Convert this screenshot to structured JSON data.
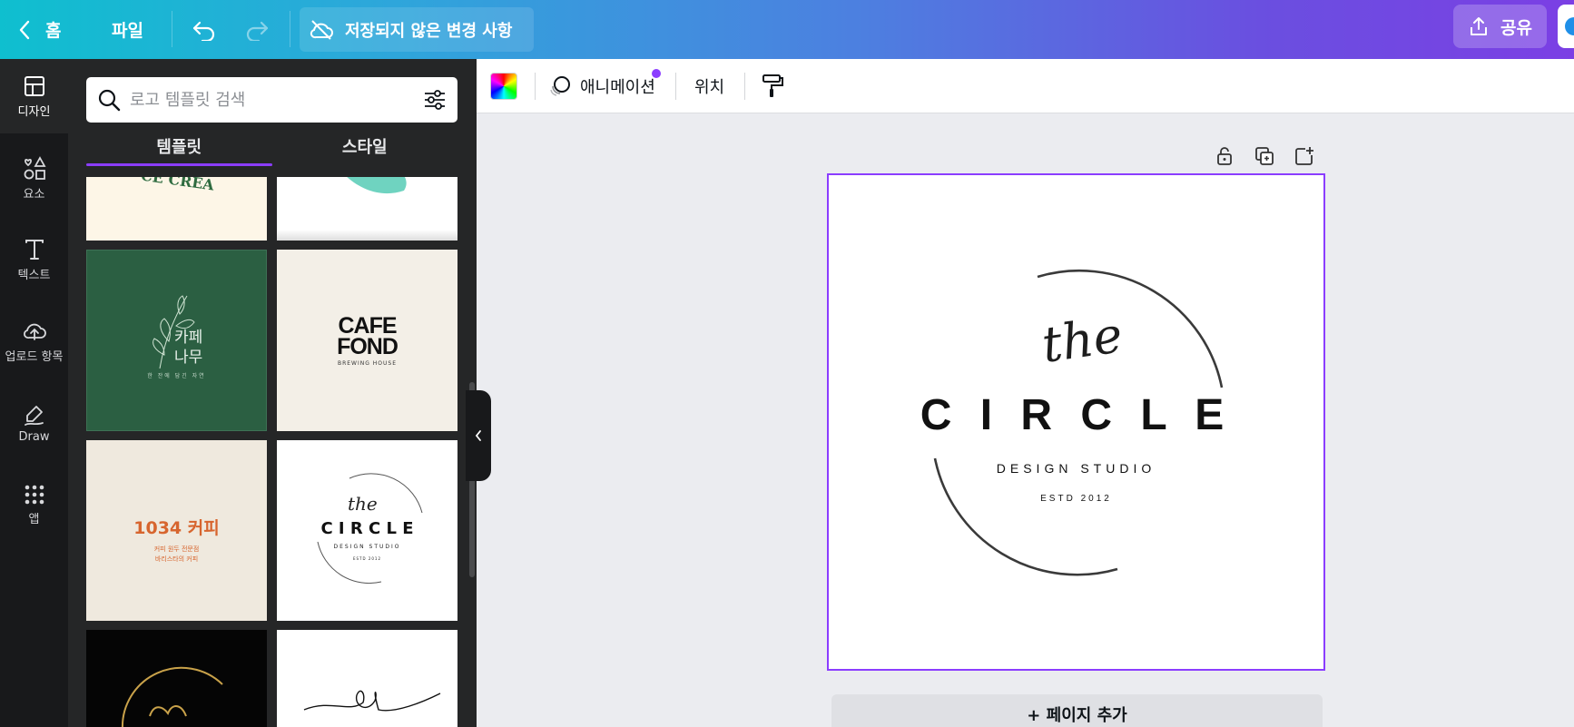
{
  "topbar": {
    "home_label": "홈",
    "file_label": "파일",
    "unsaved_label": "저장되지 않은 변경 사항",
    "share_label": "공유"
  },
  "rail": {
    "items": [
      {
        "label": "디자인",
        "icon": "layout-icon"
      },
      {
        "label": "요소",
        "icon": "shapes-icon"
      },
      {
        "label": "텍스트",
        "icon": "text-icon"
      },
      {
        "label": "업로드 항목",
        "icon": "cloud-upload-icon"
      },
      {
        "label": "Draw",
        "icon": "draw-icon"
      },
      {
        "label": "앱",
        "icon": "apps-grid-icon"
      }
    ]
  },
  "panel": {
    "search_placeholder": "로고 템플릿 검색",
    "tabs": [
      {
        "label": "템플릿"
      },
      {
        "label": "스타일"
      }
    ],
    "templates": {
      "t1": {
        "text": "CE CREA"
      },
      "t3": {
        "title_line1": "카페",
        "title_line2": "나무",
        "subtitle": "한 잔에 담긴 자연"
      },
      "t4": {
        "line1": "CAFE",
        "line2": "FOND",
        "subtitle": "BREWING HOUSE"
      },
      "t5": {
        "title": "1034 커피",
        "line1": "커피 원두 전문점",
        "line2": "바리스타의 커피"
      },
      "t6": {
        "script": "the",
        "title": "C I R C L E",
        "subtitle": "DESIGN STUDIO",
        "estd": "ESTD 2012"
      }
    }
  },
  "toolbar": {
    "animation_label": "애니메이션",
    "position_label": "위치"
  },
  "canvas": {
    "logo_script": "the",
    "logo_title": "C I R C L E",
    "logo_subtitle": "DESIGN STUDIO",
    "logo_estd": "ESTD 2012",
    "add_page_label": "+ 페이지 추가"
  },
  "colors": {
    "accent": "#8b3dff",
    "rail_bg": "#18191b",
    "panel_bg": "#252627",
    "canvas_bg": "#ebecf0"
  }
}
